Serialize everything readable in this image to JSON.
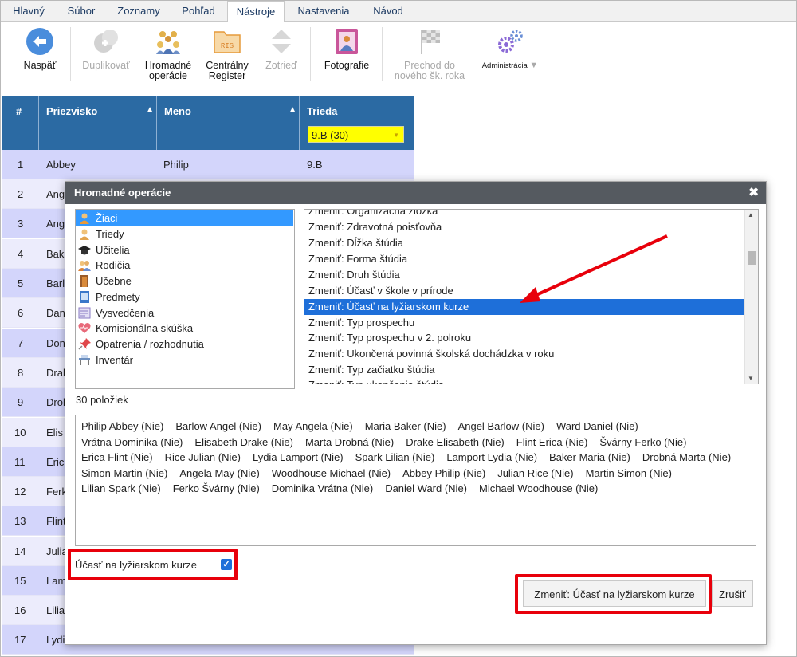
{
  "menu": {
    "tabs": [
      "Hlavný",
      "Súbor",
      "Zoznamy",
      "Pohľad",
      "Nástroje",
      "Nastavenia",
      "Návod"
    ],
    "active": "Nástroje"
  },
  "toolbar": {
    "back": "Naspäť",
    "duplicate": "Duplikovať",
    "bulk_line1": "Hromadné",
    "bulk_line2": "operácie",
    "central_line1": "Centrálny",
    "central_line2": "Register",
    "central_icon_text": "RIS",
    "sort": "Zotrieď",
    "photos": "Fotografie",
    "transfer_line1": "Prechod do",
    "transfer_line2": "nového šk. roka",
    "admin": "Administrácia"
  },
  "grid": {
    "headers": {
      "num": "#",
      "surname": "Priezvisko",
      "name": "Meno",
      "class": "Trieda"
    },
    "class_filter": "9.B (30)",
    "rows": [
      {
        "n": "1",
        "surname": "Abbey",
        "name": "Philip",
        "cls": "9.B"
      },
      {
        "n": "2",
        "surname": "Ang"
      },
      {
        "n": "3",
        "surname": "Ang"
      },
      {
        "n": "4",
        "surname": "Bak"
      },
      {
        "n": "5",
        "surname": "Barl"
      },
      {
        "n": "6",
        "surname": "Dan"
      },
      {
        "n": "7",
        "surname": "Don"
      },
      {
        "n": "8",
        "surname": "Dral"
      },
      {
        "n": "9",
        "surname": "Drol"
      },
      {
        "n": "10",
        "surname": "Elis"
      },
      {
        "n": "11",
        "surname": "Eric"
      },
      {
        "n": "12",
        "surname": "Ferk"
      },
      {
        "n": "13",
        "surname": "Flint"
      },
      {
        "n": "14",
        "surname": "Julia"
      },
      {
        "n": "15",
        "surname": "Lam"
      },
      {
        "n": "16",
        "surname": "Lilia"
      },
      {
        "n": "17",
        "surname": "Lydi"
      }
    ]
  },
  "dialog": {
    "title": "Hromadné operácie",
    "close_icon": "✖",
    "categories": [
      {
        "label": "Žiaci",
        "icon": "student-icon"
      },
      {
        "label": "Triedy",
        "icon": "class-icon"
      },
      {
        "label": "Učitelia",
        "icon": "graduation-cap-icon"
      },
      {
        "label": "Rodičia",
        "icon": "parents-icon"
      },
      {
        "label": "Učebne",
        "icon": "door-icon"
      },
      {
        "label": "Predmety",
        "icon": "book-icon"
      },
      {
        "label": "Vysvedčenia",
        "icon": "certificate-icon"
      },
      {
        "label": "Komisionálna skúška",
        "icon": "heart-exam-icon"
      },
      {
        "label": "Opatrenia / rozhodnutia",
        "icon": "pin-icon"
      },
      {
        "label": "Inventár",
        "icon": "desk-icon"
      }
    ],
    "operations": [
      "Zmeniť: Organizačná zložka",
      "Zmeniť: Zdravotná poisťovňa",
      "Zmeniť: Dĺžka štúdia",
      "Zmeniť: Forma štúdia",
      "Zmeniť: Druh štúdia",
      "Zmeniť: Účasť v škole v prírode",
      "Zmeniť: Účasť na lyžiarskom kurze",
      "Zmeniť: Typ prospechu",
      "Zmeniť: Typ prospechu v 2. polroku",
      "Zmeniť: Ukončená povinná školská dochádzka v roku",
      "Zmeniť: Typ začiatku štúdia",
      "Zmeniť: Typ ukončenia štúdia"
    ],
    "selected_operation": "Zmeniť: Účasť na lyžiarskom kurze",
    "count_label": "30 položiek",
    "names": [
      "Philip Abbey (Nie)",
      "Barlow Angel (Nie)",
      "May Angela (Nie)",
      "Maria Baker (Nie)",
      "Angel Barlow (Nie)",
      "Ward Daniel (Nie)",
      "Vrátna Dominika (Nie)",
      "Elisabeth Drake (Nie)",
      "Marta Drobná (Nie)",
      "Drake Elisabeth (Nie)",
      "Flint Erica (Nie)",
      "Švárny Ferko (Nie)",
      "Erica Flint (Nie)",
      "Rice Julian (Nie)",
      "Lydia Lamport (Nie)",
      "Spark Lilian (Nie)",
      "Lamport Lydia (Nie)",
      "Baker Maria (Nie)",
      "Drobná Marta (Nie)",
      "Simon Martin (Nie)",
      "Angela May (Nie)",
      "Woodhouse Michael (Nie)",
      "Abbey Philip (Nie)",
      "Julian Rice (Nie)",
      "Martin Simon (Nie)",
      "Lilian Spark (Nie)",
      "Ferko Švárny (Nie)",
      "Dominika Vrátna (Nie)",
      "Daniel Ward (Nie)",
      "Michael Woodhouse (Nie)"
    ],
    "checkbox_label": "Účasť na lyžiarskom kurze",
    "checkbox_checked": true,
    "confirm_button": "Zmeniť: Účasť na lyžiarskom kurze",
    "cancel_button": "Zrušiť"
  },
  "colors": {
    "header_blue": "#2b6aa3",
    "row_odd": "#d3d5fb",
    "row_even": "#ececfc",
    "selection_blue": "#1e6fd9",
    "filter_yellow": "#ffff00",
    "annotation_red": "#e8000b"
  }
}
